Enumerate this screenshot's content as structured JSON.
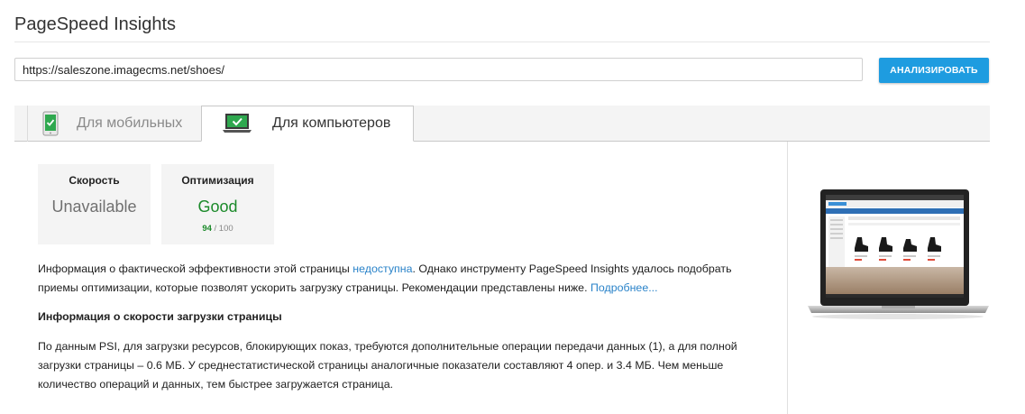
{
  "header": {
    "title": "PageSpeed Insights"
  },
  "search": {
    "url_value": "https://saleszone.imagecms.net/shoes/",
    "analyze_label": "АНАЛИЗИРОВАТЬ"
  },
  "tabs": [
    {
      "label": "Для мобильных",
      "active": false
    },
    {
      "label": "Для компьютеров",
      "active": true
    }
  ],
  "scores": {
    "speed": {
      "title": "Скорость",
      "value": "Unavailable"
    },
    "optimization": {
      "title": "Оптимизация",
      "value": "Good",
      "score": "94",
      "score_max": "/ 100"
    }
  },
  "content": {
    "p1_a": "Информация о фактической эффективности этой страницы ",
    "p1_link1": "недоступна",
    "p1_b": ". Однако инструменту PageSpeed Insights удалось подобрать приемы оптимизации, которые позволят ускорить загрузку страницы. Рекомендации представлены ниже. ",
    "p1_link2": "Подробнее...",
    "speed_heading": "Информация о скорости загрузки страницы",
    "p2": "По данным PSI, для загрузки ресурсов, блокирующих показ, требуются дополнительные операции передачи данных (1), а для полной загрузки страницы – 0.6 МБ. У среднестатистической страницы аналогичные показатели составляют 4 опер. и 3.4 МБ. Чем меньше количество операций и данных, тем быстрее загружается страница."
  },
  "colors": {
    "accent": "#1e9ce0",
    "good": "#1b8a2a",
    "link": "#2a83c9"
  }
}
